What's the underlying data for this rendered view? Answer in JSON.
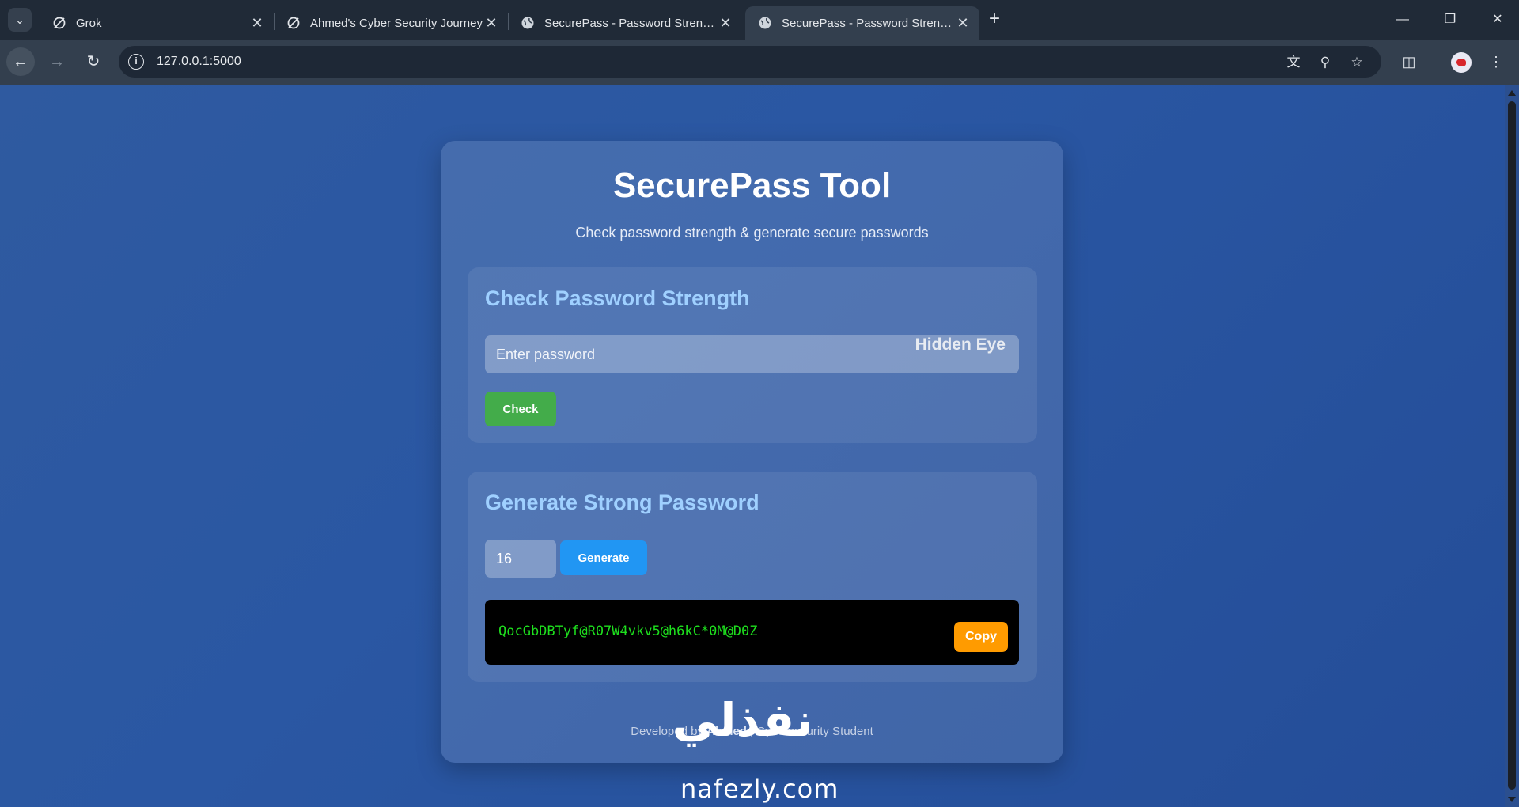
{
  "browser": {
    "tabs": [
      {
        "title": "Grok",
        "icon": "grok-icon",
        "active": false
      },
      {
        "title": "Ahmed's Cyber Security Journey",
        "icon": "grok-icon",
        "active": false
      },
      {
        "title": "SecurePass - Password Strength",
        "icon": "globe-icon",
        "active": false
      },
      {
        "title": "SecurePass - Password Strength",
        "icon": "globe-icon",
        "active": true
      }
    ],
    "url": "127.0.0.1:5000"
  },
  "page": {
    "title": "SecurePass Tool",
    "subtitle": "Check password strength & generate secure passwords",
    "check_section": {
      "heading": "Check Password Strength",
      "password_placeholder": "Enter password",
      "eye_label": "Hidden Eye",
      "check_button": "Check"
    },
    "generate_section": {
      "heading": "Generate Strong Password",
      "length_value": "16",
      "generate_button": "Generate",
      "generated_password": "QocGbDBTyf@R07W4vkv5@h6kC*0M@D0Z",
      "copy_button": "Copy"
    },
    "footer": {
      "prefix": "Developed by ",
      "author": "Ahmed",
      "suffix": " | Cybersecurity Student"
    }
  },
  "watermark": {
    "arabic": "نفذلي",
    "latin": "nafezly.com"
  },
  "colors": {
    "background": "#2a57a3",
    "heading_accent": "#9fd0ff",
    "check_button": "#43ac4a",
    "generate_button": "#2196f3",
    "copy_button": "#ff9b00",
    "password_text": "#1ee01e"
  }
}
